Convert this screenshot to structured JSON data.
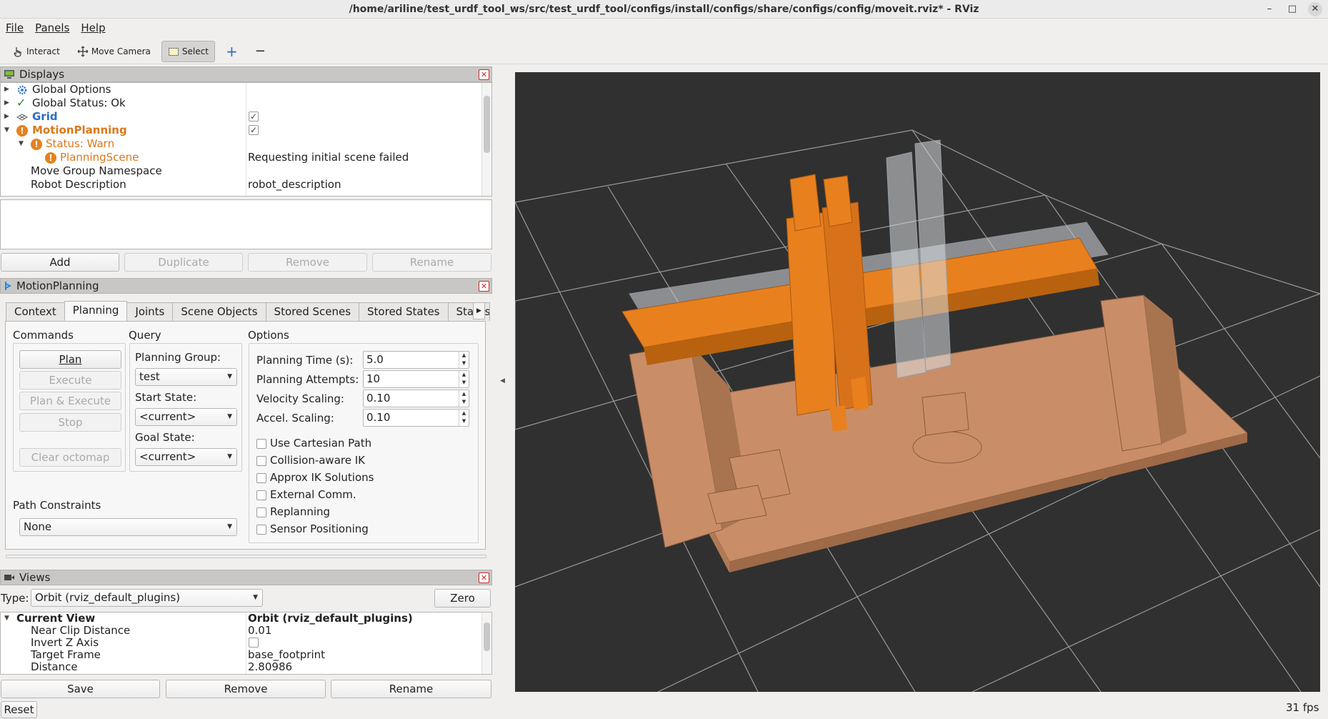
{
  "window": {
    "title": "/home/ariline/test_urdf_tool_ws/src/test_urdf_tool/configs/install/configs/share/configs/config/moveit.rviz* - RViz",
    "min": "–",
    "max": "□",
    "close": "✕"
  },
  "menu": [
    "File",
    "Panels",
    "Help"
  ],
  "toolbar": {
    "interact": "Interact",
    "move_camera": "Move Camera",
    "select": "Select",
    "plus": "+",
    "minus": "−"
  },
  "displays": {
    "title": "Displays",
    "rows": [
      {
        "label": "Global Options",
        "value": ""
      },
      {
        "label": "Global Status: Ok",
        "value": ""
      },
      {
        "label": "Grid",
        "value": ""
      },
      {
        "label": "MotionPlanning",
        "value": ""
      },
      {
        "label": "Status: Warn",
        "value": ""
      },
      {
        "label": "PlanningScene",
        "value": "Requesting initial scene failed"
      },
      {
        "label": "Move Group Namespace",
        "value": ""
      },
      {
        "label": "Robot Description",
        "value": "robot_description"
      }
    ],
    "buttons": {
      "add": "Add",
      "duplicate": "Duplicate",
      "remove": "Remove",
      "rename": "Rename"
    }
  },
  "motion": {
    "title": "MotionPlanning",
    "tabs": [
      "Context",
      "Planning",
      "Joints",
      "Scene Objects",
      "Stored Scenes",
      "Stored States",
      "Status"
    ],
    "commands": {
      "title": "Commands",
      "plan": "Plan",
      "execute": "Execute",
      "plan_execute": "Plan & Execute",
      "stop": "Stop",
      "clear": "Clear octomap"
    },
    "query": {
      "title": "Query",
      "group_label": "Planning Group:",
      "group": "test",
      "start_label": "Start State:",
      "start": "<current>",
      "goal_label": "Goal State:",
      "goal": "<current>"
    },
    "options": {
      "title": "Options",
      "time_label": "Planning Time (s):",
      "time": "5.0",
      "attempts_label": "Planning Attempts:",
      "attempts": "10",
      "vel_label": "Velocity Scaling:",
      "vel": "0.10",
      "acc_label": "Accel. Scaling:",
      "acc": "0.10",
      "checks": [
        "Use Cartesian Path",
        "Collision-aware IK",
        "Approx IK Solutions",
        "External Comm.",
        "Replanning",
        "Sensor Positioning"
      ]
    },
    "path": {
      "title": "Path Constraints",
      "value": "None"
    }
  },
  "views": {
    "title": "Views",
    "type_label": "Type:",
    "type": "Orbit (rviz_default_plugins)",
    "zero": "Zero",
    "rows": [
      {
        "label": "Current View",
        "value": "Orbit (rviz_default_plugins)"
      },
      {
        "label": "Near Clip Distance",
        "value": "0.01"
      },
      {
        "label": "Invert Z Axis",
        "value": ""
      },
      {
        "label": "Target Frame",
        "value": "base_footprint"
      },
      {
        "label": "Distance",
        "value": "2.80986"
      }
    ],
    "buttons": {
      "save": "Save",
      "remove": "Remove",
      "rename": "Rename"
    }
  },
  "status": {
    "reset": "Reset",
    "fps": "31 fps"
  },
  "colors": {
    "viewport": "#303030",
    "robot": "#e8801e",
    "base": "#c98e68",
    "ghost": "#c8ccd0",
    "warn": "#e8801e",
    "link": "#2a6ac8"
  }
}
